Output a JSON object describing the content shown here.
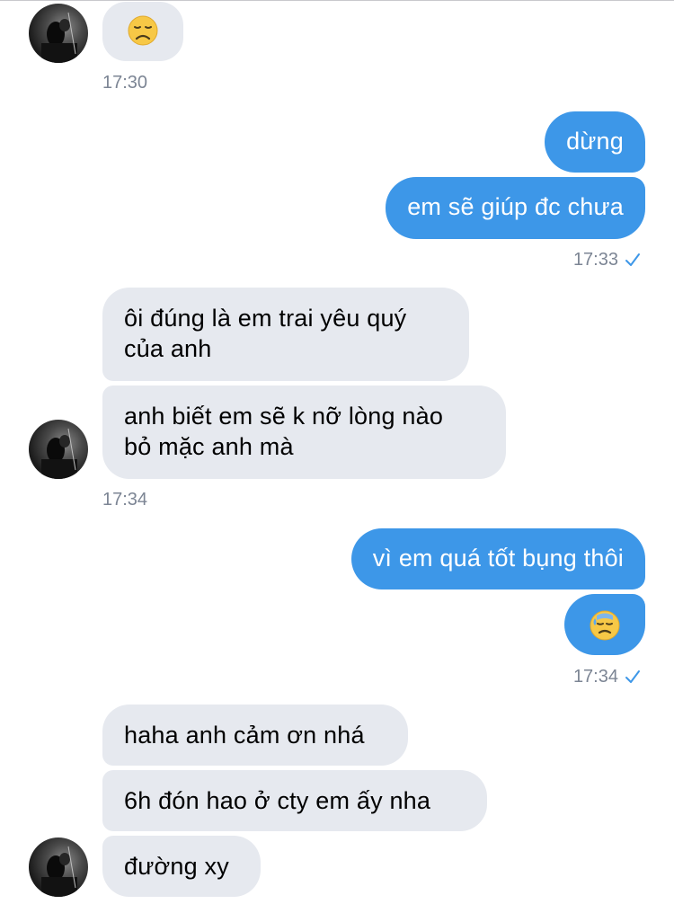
{
  "messages": [
    {
      "id": "m1",
      "direction": "incoming",
      "text": "😞"
    },
    {
      "id": "t1",
      "time": "17:30"
    },
    {
      "id": "m2",
      "direction": "outgoing",
      "text": "dừng"
    },
    {
      "id": "m3",
      "direction": "outgoing",
      "text": "em sẽ giúp đc chưa"
    },
    {
      "id": "t2",
      "time": "17:33",
      "read": true
    },
    {
      "id": "m4",
      "direction": "incoming",
      "text_lines": [
        "ôi đúng là em trai yêu quý",
        "của anh"
      ]
    },
    {
      "id": "m5",
      "direction": "incoming",
      "text_lines": [
        "anh biết em sẽ k nỡ lòng nào",
        "bỏ mặc anh mà"
      ]
    },
    {
      "id": "t3",
      "time": "17:34"
    },
    {
      "id": "m6",
      "direction": "outgoing",
      "text": "vì em quá tốt bụng thôi"
    },
    {
      "id": "m7",
      "direction": "outgoing",
      "text": "😓"
    },
    {
      "id": "t4",
      "time": "17:34",
      "read": true
    },
    {
      "id": "m8",
      "direction": "incoming",
      "text": "haha anh cảm ơn nhá"
    },
    {
      "id": "m9",
      "direction": "incoming",
      "text": "6h đón hao ở cty em ấy nha"
    },
    {
      "id": "m10",
      "direction": "incoming",
      "text": "đường xy"
    }
  ],
  "emoji": {
    "m1": "disappointed-face",
    "m7": "downcast-face-with-sweat"
  },
  "colors": {
    "incoming_bubble": "#e6e9ef",
    "outgoing_bubble": "#3d97e8",
    "timestamp": "#7c8594",
    "read_check": "#3d97e8"
  }
}
